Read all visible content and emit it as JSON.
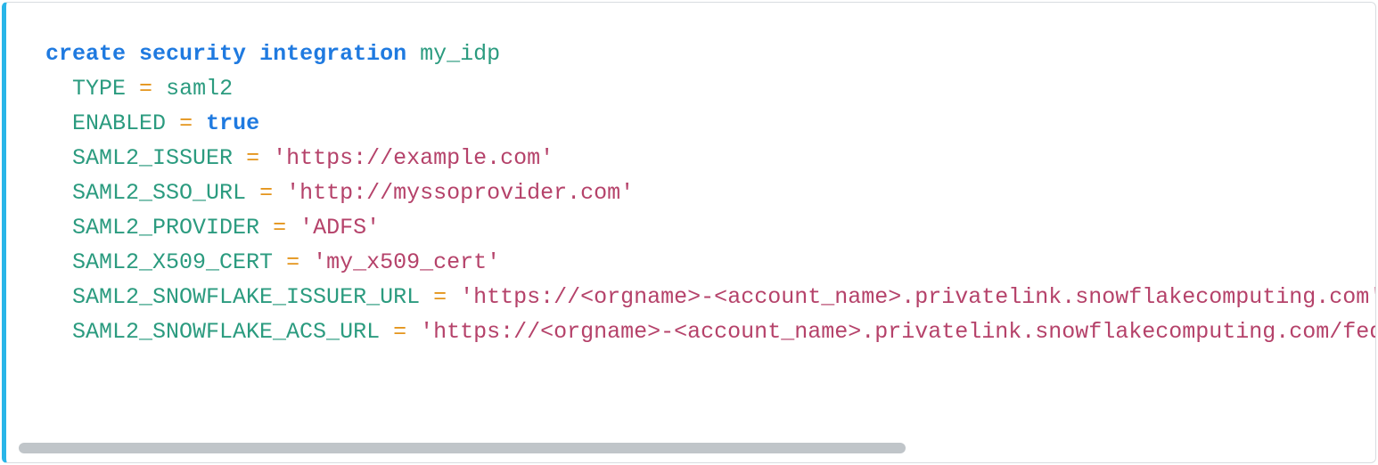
{
  "code": {
    "line1": {
      "kw1": "create",
      "kw2": "security",
      "kw3": "integration",
      "name": "my_idp"
    },
    "line2": {
      "key": "TYPE",
      "op": "=",
      "val": "saml2"
    },
    "line3": {
      "key": "ENABLED",
      "op": "=",
      "val": "true"
    },
    "line4": {
      "key": "SAML2_ISSUER",
      "op": "=",
      "val": "'https://example.com'"
    },
    "line5": {
      "key": "SAML2_SSO_URL",
      "op": "=",
      "val": "'http://myssoprovider.com'"
    },
    "line6": {
      "key": "SAML2_PROVIDER",
      "op": "=",
      "val": "'ADFS'"
    },
    "line7": {
      "key": "SAML2_X509_CERT",
      "op": "=",
      "val": "'my_x509_cert'"
    },
    "line8": {
      "key": "SAML2_SNOWFLAKE_ISSUER_URL",
      "op": "=",
      "val": "'https://<orgname>-<account_name>.privatelink.snowflakecomputing.com'"
    },
    "line9": {
      "key": "SAML2_SNOWFLAKE_ACS_URL",
      "op": "=",
      "val": "'https://<orgname>-<account_name>.privatelink.snowflakecomputing.com/fed/login'"
    }
  }
}
